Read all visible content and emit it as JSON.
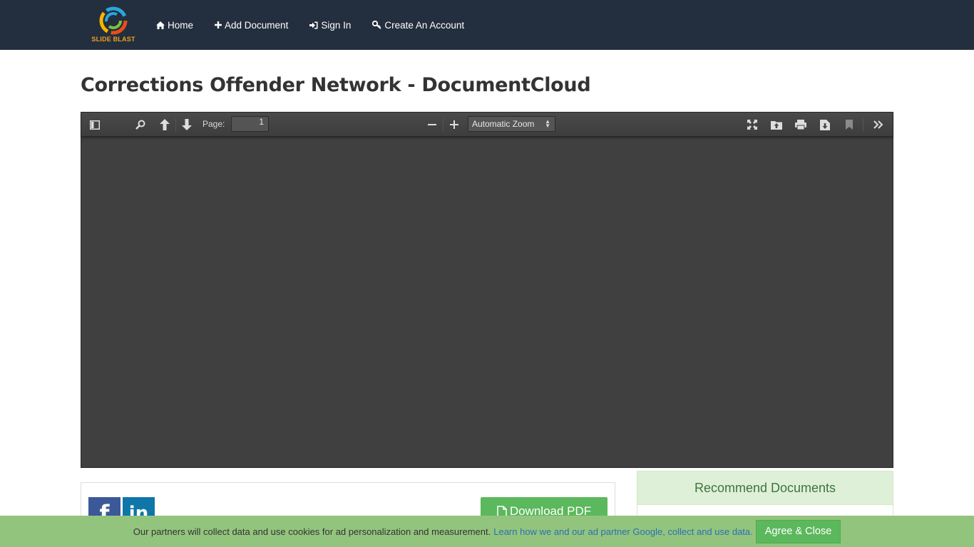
{
  "brand": {
    "name": "SLIDE BLAST",
    "accent": "#f0a020"
  },
  "nav": {
    "items": [
      {
        "label": "Home",
        "icon": "home-icon"
      },
      {
        "label": "Add Document",
        "icon": "plus-icon"
      },
      {
        "label": "Sign In",
        "icon": "sign-in-icon"
      },
      {
        "label": "Create An Account",
        "icon": "key-icon"
      }
    ]
  },
  "page": {
    "title": "Corrections Offender Network - DocumentCloud"
  },
  "viewer": {
    "page_label": "Page:",
    "page_value": "1",
    "zoom_label": "Automatic Zoom"
  },
  "share": {
    "facebook": "f",
    "linkedin": "in",
    "download_label": "Download PDF"
  },
  "recommend": {
    "heading": "Recommend Documents"
  },
  "cookie": {
    "text": "Our partners will collect data and use cookies for ad personalization and measurement.",
    "link": "Learn how we and our ad partner Google, collect and use data.",
    "button": "Agree & Close"
  }
}
